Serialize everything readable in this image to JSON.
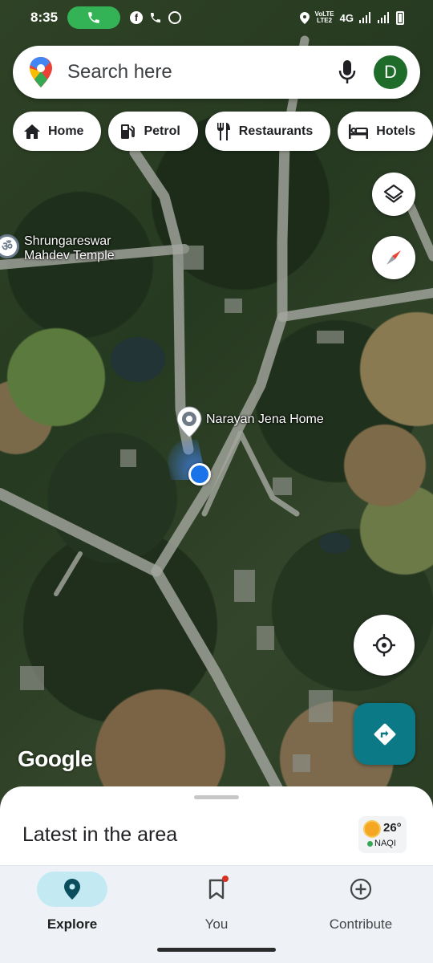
{
  "status_bar": {
    "time": "8:35",
    "network_top": "VoLTE",
    "network_bottom": "LTE2",
    "network_type": "4G",
    "icons": [
      "call-icon",
      "facebook-icon",
      "phone-icon",
      "whatsapp-icon",
      "location-icon",
      "signal-icon",
      "battery-icon"
    ]
  },
  "search": {
    "placeholder": "Search here",
    "avatar_letter": "D",
    "avatar_color": "#1e6b2a"
  },
  "chips": [
    {
      "label": "Home",
      "icon": "home-icon"
    },
    {
      "label": "Petrol",
      "icon": "fuel-icon"
    },
    {
      "label": "Restaurants",
      "icon": "restaurant-icon"
    },
    {
      "label": "Hotels",
      "icon": "hotel-icon"
    }
  ],
  "map": {
    "pois": {
      "temple": {
        "name": "Shrungareswar Mahdev Temple",
        "line1": "Shrungareswar",
        "line2": "Mahdev Temple",
        "icon": "om-icon"
      },
      "saved_place": {
        "name": "Narayan Jena Home",
        "icon": "place-pin-icon"
      }
    },
    "attribution": "Google"
  },
  "bottom_sheet": {
    "title": "Latest in the area",
    "weather": {
      "temperature": "26°",
      "aqi_label": "NAQI",
      "aqi_color": "#34a853"
    }
  },
  "nav": {
    "items": [
      {
        "label": "Explore",
        "icon": "explore-pin-icon",
        "active": true
      },
      {
        "label": "You",
        "icon": "bookmark-icon",
        "active": false
      },
      {
        "label": "Contribute",
        "icon": "add-circle-icon",
        "active": false
      }
    ]
  },
  "colors": {
    "accent": "#0b7a86",
    "location_blue": "#1a73e8",
    "nav_active": "#c3eaf3"
  }
}
